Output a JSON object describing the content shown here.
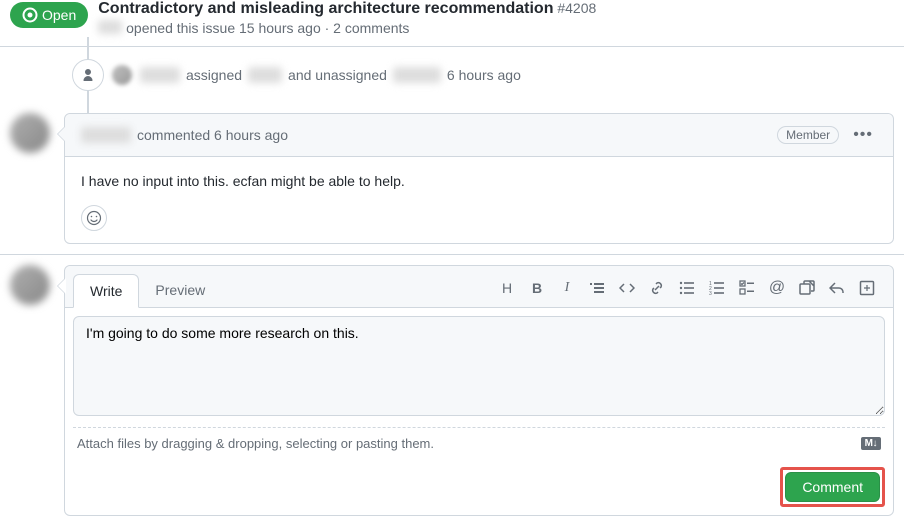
{
  "header": {
    "status": "Open",
    "title": "Contradictory and misleading architecture recommendation",
    "issueNumber": "#4208",
    "subline_opened": "opened this issue 15 hours ago · 2 comments"
  },
  "timeline": {
    "assign_action1": "assigned",
    "assign_action2": "and unassigned",
    "assign_time": "6 hours ago"
  },
  "comment": {
    "action": "commented 6 hours ago",
    "badge": "Member",
    "body": "I have no input into this. ecfan might be able to help."
  },
  "newComment": {
    "tabs": {
      "write": "Write",
      "preview": "Preview"
    },
    "textareaValue": "I'm going to do some more research on this.",
    "attachHint": "Attach files by dragging & dropping, selecting or pasting them.",
    "mdLabel": "M↓",
    "submit": "Comment"
  }
}
